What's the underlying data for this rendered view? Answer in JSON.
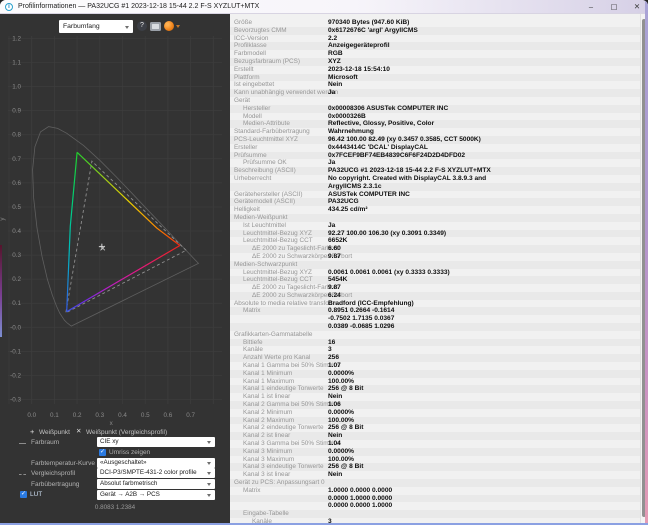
{
  "window": {
    "title": "Profilinformationen — PA32UCG #1 2023-12-18 15-44 2.2 F-S XYZLUT+MTX",
    "icon": "info-icon",
    "minimize": "–",
    "maximize": "▢",
    "close": "✕"
  },
  "toolbar": {
    "view_select_value": "Farbumfang",
    "help_icon": "?",
    "report_icon": "report-image-icon",
    "profile_icon": "install-profile-icon"
  },
  "colors": {
    "panel_dark": "#333333",
    "panel_light": "#f1f1f1",
    "accent_checkbox": "#2a7ae2",
    "grid": "#3d3d3d",
    "gamut_green": "#21d02c",
    "gamut_red": "#eb2418",
    "gamut_blue": "#3355e8",
    "comparison_dash": "#8f8f8f"
  },
  "plot": {
    "type": "chromaticity-diagram CIE xy",
    "xlabel": "x",
    "ylabel": "y",
    "x_tick_labels": [
      "0.0",
      "0.1",
      "0.2",
      "0.3",
      "0.4",
      "0.5",
      "0.6",
      "0.7"
    ],
    "y_tick_labels": [
      "1.2",
      "1.1",
      "1.0",
      "0.9",
      "0.8",
      "0.7",
      "0.6",
      "0.5",
      "0.4",
      "0.3",
      "0.2",
      "0.1",
      "-0.0",
      "-0.1",
      "-0.2",
      "-0.3"
    ],
    "xlim": [
      -0.1,
      0.84
    ],
    "ylim": [
      -0.38,
      1.2
    ],
    "gamut_polygon": [
      [
        0.2,
        0.727
      ],
      [
        0.551,
        0.412
      ],
      [
        0.653,
        0.34
      ],
      [
        0.154,
        0.065
      ],
      [
        0.17,
        0.42
      ]
    ],
    "comparison_triangle": [
      [
        0.68,
        0.32
      ],
      [
        0.265,
        0.69
      ],
      [
        0.15,
        0.06
      ]
    ],
    "whitepoint": [
      0.3091,
      0.3349
    ],
    "whitepoint_comparison": [
      0.3127,
      0.329
    ],
    "spectral_locus": [
      [
        0.1741,
        0.005
      ],
      [
        0.1566,
        0.0177
      ],
      [
        0.144,
        0.0297
      ],
      [
        0.1241,
        0.0578
      ],
      [
        0.1096,
        0.0868
      ],
      [
        0.0913,
        0.1327
      ],
      [
        0.0687,
        0.2007
      ],
      [
        0.0454,
        0.295
      ],
      [
        0.0235,
        0.4127
      ],
      [
        0.0082,
        0.5384
      ],
      [
        0.0039,
        0.6548
      ],
      [
        0.0139,
        0.7502
      ],
      [
        0.0389,
        0.812
      ],
      [
        0.0743,
        0.8338
      ],
      [
        0.1142,
        0.8262
      ],
      [
        0.1547,
        0.8059
      ],
      [
        0.2296,
        0.7543
      ],
      [
        0.3016,
        0.6923
      ],
      [
        0.3731,
        0.6245
      ],
      [
        0.4441,
        0.5547
      ],
      [
        0.5125,
        0.4866
      ],
      [
        0.5752,
        0.4242
      ],
      [
        0.627,
        0.3725
      ],
      [
        0.6658,
        0.334
      ],
      [
        0.6915,
        0.3083
      ],
      [
        0.719,
        0.2809
      ],
      [
        0.7347,
        0.2653
      ]
    ]
  },
  "legend": {
    "wp_glyph": "+",
    "wp_label": "Weißpunkt",
    "wpc_glyph": "✕",
    "wpc_label": "Weißpunkt (Vergleichsprofil)"
  },
  "controls": {
    "farbraum": {
      "label": "Farbraum",
      "value": "CIE xy"
    },
    "umriss": {
      "label": "Umriss zeigen",
      "checked": "✓"
    },
    "kurve": {
      "label": "Farbtemperatur-Kurve",
      "value": "«Ausgeschaltet»"
    },
    "vergleich": {
      "label": "Vergleichsprofil",
      "value": "DCI-P3/SMPTE-431-2 color profile"
    },
    "uebertragung": {
      "label": "Farbübertragung",
      "value": "Absolut farbmetrisch"
    },
    "lut": {
      "label": "LUT",
      "checked": "✓",
      "value": "Gerät → A2B → PCS"
    }
  },
  "statusbar": {
    "coordinates": "0.8083 1.2384"
  },
  "info": {
    "rows": [
      {
        "l": "Größe",
        "v": "970340 Bytes (947.60 KiB)",
        "d": 0
      },
      {
        "l": "Bevorzugtes CMM",
        "v": "0x6172676C 'argl' ArgyllCMS",
        "d": 0
      },
      {
        "l": "ICC-Version",
        "v": "2.2",
        "d": 0
      },
      {
        "l": "Profilklasse",
        "v": "Anzeigegeräteprofil",
        "d": 0
      },
      {
        "l": "Farbmodell",
        "v": "RGB",
        "d": 0
      },
      {
        "l": "Bezugsfarbraum (PCS)",
        "v": "XYZ",
        "d": 0
      },
      {
        "l": "Erstellt",
        "v": "2023-12-18 15:54:10",
        "d": 0
      },
      {
        "l": "Plattform",
        "v": "Microsoft",
        "d": 0
      },
      {
        "l": "Ist eingebettet",
        "v": "Nein",
        "d": 0
      },
      {
        "l": "Kann unabhängig verwendet werden",
        "v": "Ja",
        "d": 0
      },
      {
        "l": "Gerät",
        "v": "",
        "d": 0
      },
      {
        "l": "Hersteller",
        "v": "0x00008306 ASUSTek COMPUTER INC",
        "d": 1
      },
      {
        "l": "Modell",
        "v": "0x0000326B",
        "d": 1
      },
      {
        "l": "Medien-Attribute",
        "v": "Reflective, Glossy, Positive, Color",
        "d": 1
      },
      {
        "l": "Standard-Farbübertragung",
        "v": "Wahrnehmung",
        "d": 0
      },
      {
        "l": "PCS-Leuchtmittel XYZ",
        "v": "96.42 100.00  82.49 (xy 0.3457 0.3585, CCT 5000K)",
        "d": 0
      },
      {
        "l": "Ersteller",
        "v": "0x4443414C 'DCAL' DisplayCAL",
        "d": 0
      },
      {
        "l": "Prüfsumme",
        "v": "0x7FCEF9BF74EB4839C6F6F24D2D4DFD02",
        "d": 0
      },
      {
        "l": "Prüfsumme OK",
        "v": "Ja",
        "d": 1
      },
      {
        "l": "Beschreibung (ASCII)",
        "v": "PA32UCG #1 2023-12-18 15-44 2.2 F-S XYZLUT+MTX",
        "d": 0
      },
      {
        "l": "Urheberrecht",
        "v": "No copyright. Created with DisplayCAL 3.8.9.3 and",
        "d": 0
      },
      {
        "l": "",
        "v": "ArgyllCMS 2.3.1c",
        "d": 0
      },
      {
        "l": "Gerätehersteller (ASCII)",
        "v": "ASUSTek COMPUTER INC",
        "d": 0
      },
      {
        "l": "Gerätemodell (ASCII)",
        "v": "PA32UCG",
        "d": 0
      },
      {
        "l": "Helligkeit",
        "v": "434.25 cd/m²",
        "d": 0
      },
      {
        "l": "Medien-Weißpunkt",
        "v": "",
        "d": 0
      },
      {
        "l": "Ist Leuchtmittel",
        "v": "Ja",
        "d": 1
      },
      {
        "l": "Leuchtmittel-Bezug XYZ",
        "v": "92.27 100.00 106.30 (xy 0.3091 0.3349)",
        "d": 1
      },
      {
        "l": "Leuchtmittel-Bezug CCT",
        "v": "6652K",
        "d": 1
      },
      {
        "l": "ΔE 2000 zu Tageslicht-Farbort",
        "v": "6.60",
        "d": 2
      },
      {
        "l": "ΔE 2000 zu Schwarzkörper-Farbort",
        "v": "9.87",
        "d": 2
      },
      {
        "l": "Medien-Schwarzpunkt",
        "v": "",
        "d": 0
      },
      {
        "l": "Leuchtmittel-Bezug XYZ",
        "v": "0.0061 0.0061 0.0061 (xy 0.3333 0.3333)",
        "d": 1
      },
      {
        "l": "Leuchtmittel-Bezug CCT",
        "v": "5454K",
        "d": 1
      },
      {
        "l": "ΔE 2000 zu Tageslicht-Farbort",
        "v": "9.87",
        "d": 2
      },
      {
        "l": "ΔE 2000 zu Schwarzkörper-Farbort",
        "v": "6.24",
        "d": 2
      },
      {
        "l": "Absolute to media relative transform",
        "v": "Bradford (ICC-Empfehlung)",
        "d": 0
      },
      {
        "l": "Matrix",
        "v": "0.8951 0.2664 -0.1614",
        "d": 1
      },
      {
        "l": "",
        "v": "-0.7502 1.7135 0.0367",
        "d": 1
      },
      {
        "l": "",
        "v": "0.0389 -0.0685 1.0296",
        "d": 1
      },
      {
        "l": "Grafikkarten-Gammatabelle",
        "v": "",
        "d": 0
      },
      {
        "l": "Bittiefe",
        "v": "16",
        "d": 1
      },
      {
        "l": "Kanäle",
        "v": "3",
        "d": 1
      },
      {
        "l": "Anzahl Werte pro Kanal",
        "v": "256",
        "d": 1
      },
      {
        "l": "Kanal 1 Gamma bei 50% Stimulus",
        "v": "1.07",
        "d": 1
      },
      {
        "l": "Kanal 1 Minimum",
        "v": "0.0000%",
        "d": 1
      },
      {
        "l": "Kanal 1 Maximum",
        "v": "100.00%",
        "d": 1
      },
      {
        "l": "Kanal 1 eindeutige Tonwerte",
        "v": "256 @ 8 Bit",
        "d": 1
      },
      {
        "l": "Kanal 1 ist linear",
        "v": "Nein",
        "d": 1
      },
      {
        "l": "Kanal 2 Gamma bei 50% Stimulus",
        "v": "1.06",
        "d": 1
      },
      {
        "l": "Kanal 2 Minimum",
        "v": "0.0000%",
        "d": 1
      },
      {
        "l": "Kanal 2 Maximum",
        "v": "100.00%",
        "d": 1
      },
      {
        "l": "Kanal 2 eindeutige Tonwerte",
        "v": "256 @ 8 Bit",
        "d": 1
      },
      {
        "l": "Kanal 2 ist linear",
        "v": "Nein",
        "d": 1
      },
      {
        "l": "Kanal 3 Gamma bei 50% Stimulus",
        "v": "1.04",
        "d": 1
      },
      {
        "l": "Kanal 3 Minimum",
        "v": "0.0000%",
        "d": 1
      },
      {
        "l": "Kanal 3 Maximum",
        "v": "100.00%",
        "d": 1
      },
      {
        "l": "Kanal 3 eindeutige Tonwerte",
        "v": "256 @ 8 Bit",
        "d": 1
      },
      {
        "l": "Kanal 3 ist linear",
        "v": "Nein",
        "d": 1
      },
      {
        "l": "Gerät zu PCS: Anpassungsart 0",
        "v": "",
        "d": 0
      },
      {
        "l": "Matrix",
        "v": "1.0000 0.0000 0.0000",
        "d": 1
      },
      {
        "l": "",
        "v": "0.0000 1.0000 0.0000",
        "d": 1
      },
      {
        "l": "",
        "v": "0.0000 0.0000 1.0000",
        "d": 1
      },
      {
        "l": "Eingabe-Tabelle",
        "v": "",
        "d": 1
      },
      {
        "l": "Kanäle",
        "v": "3",
        "d": 2
      }
    ]
  }
}
